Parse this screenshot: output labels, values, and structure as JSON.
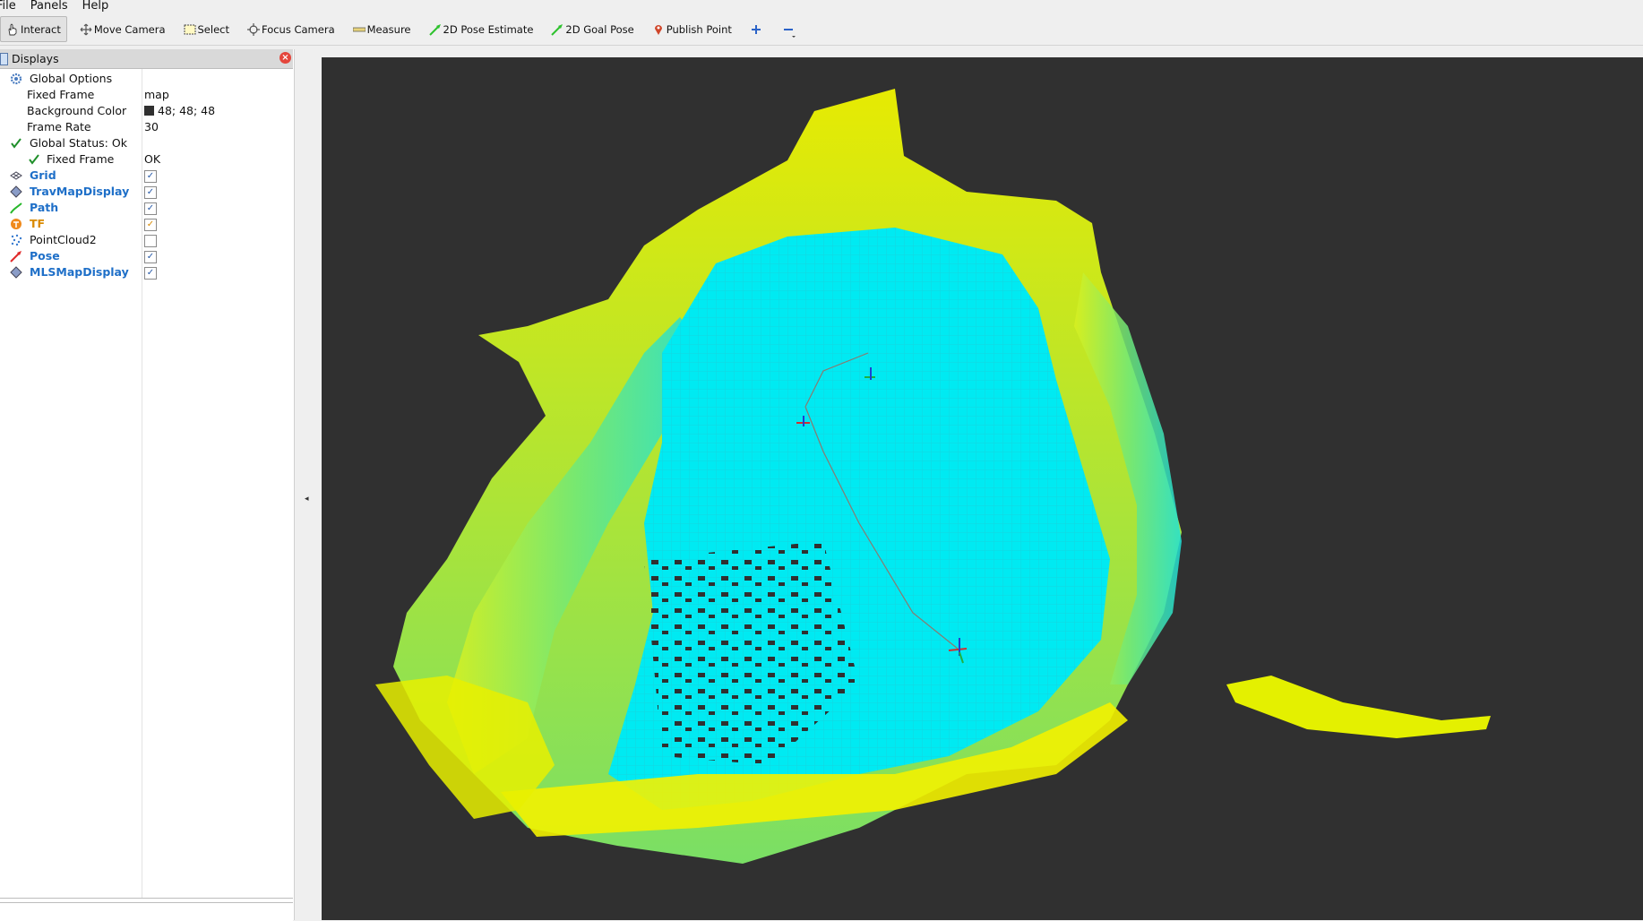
{
  "menubar": {
    "items": [
      "File",
      "Panels",
      "Help"
    ]
  },
  "toolbar": {
    "tools": [
      {
        "label": "Interact",
        "icon": "hand-icon"
      },
      {
        "label": "Move Camera",
        "icon": "move-camera-icon"
      },
      {
        "label": "Select",
        "icon": "select-icon"
      },
      {
        "label": "Focus Camera",
        "icon": "focus-camera-icon"
      },
      {
        "label": "Measure",
        "icon": "ruler-icon"
      },
      {
        "label": "2D Pose Estimate",
        "icon": "pose-arrow-icon"
      },
      {
        "label": "2D Goal Pose",
        "icon": "goal-arrow-icon"
      },
      {
        "label": "Publish Point",
        "icon": "map-pin-icon"
      }
    ]
  },
  "displays": {
    "title": "Displays",
    "global_options": {
      "label": "Global Options",
      "fixed_frame_label": "Fixed Frame",
      "fixed_frame_value": "map",
      "background_color_label": "Background Color",
      "background_color_value": "48; 48; 48",
      "frame_rate_label": "Frame Rate",
      "frame_rate_value": "30"
    },
    "global_status": {
      "label": "Global Status: Ok",
      "fixed_frame_label": "Fixed Frame",
      "fixed_frame_value": "OK"
    },
    "items": [
      {
        "label": "Grid",
        "checked": true,
        "icon": "grid-icon"
      },
      {
        "label": "TravMapDisplay",
        "checked": true,
        "icon": "diamond-icon"
      },
      {
        "label": "Path",
        "checked": true,
        "icon": "path-icon"
      },
      {
        "label": "TF",
        "checked": true,
        "icon": "tf-icon"
      },
      {
        "label": "PointCloud2",
        "checked": false,
        "icon": "pointcloud-icon"
      },
      {
        "label": "Pose",
        "checked": true,
        "icon": "pose-icon"
      },
      {
        "label": "MLSMapDisplay",
        "checked": true,
        "icon": "diamond-icon"
      }
    ],
    "check_glyph": "✓"
  },
  "colors": {
    "viewport_bg": "#303030",
    "cyan": "#00e6f0",
    "yellow": "#f4f400",
    "link_blue": "#1e6fc8"
  }
}
